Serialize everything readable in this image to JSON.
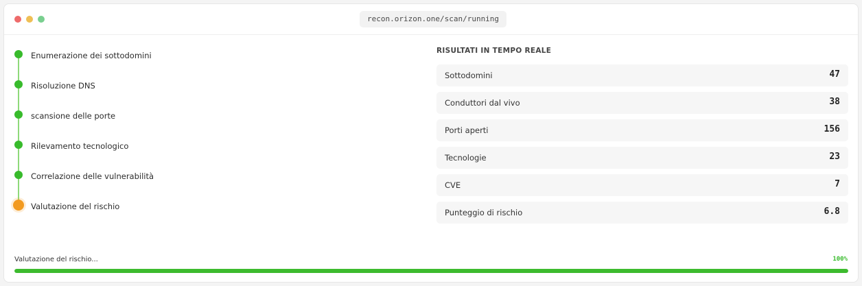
{
  "window": {
    "url": "recon.orizon.one/scan/running"
  },
  "steps": [
    {
      "label": "Enumerazione dei sottodomini",
      "status": "done"
    },
    {
      "label": "Risoluzione DNS",
      "status": "done"
    },
    {
      "label": "scansione delle porte",
      "status": "done"
    },
    {
      "label": "Rilevamento tecnologico",
      "status": "done"
    },
    {
      "label": "Correlazione delle vulnerabilità",
      "status": "done"
    },
    {
      "label": "Valutazione del rischio",
      "status": "active"
    }
  ],
  "results": {
    "title": "RISULTATI IN TEMPO REALE",
    "rows": [
      {
        "label": "Sottodomini",
        "value": "47"
      },
      {
        "label": "Conduttori dal vivo",
        "value": "38"
      },
      {
        "label": "Porti aperti",
        "value": "156"
      },
      {
        "label": "Tecnologie",
        "value": "23"
      },
      {
        "label": "CVE",
        "value": "7"
      },
      {
        "label": "Punteggio di rischio",
        "value": "6.8"
      }
    ]
  },
  "progress": {
    "status_text": "Valutazione del rischio...",
    "percent_label": "100%",
    "fraction": 1.0
  },
  "colors": {
    "done": "#38bb2c",
    "active": "#f29a1f",
    "progress": "#3dbb2e"
  }
}
